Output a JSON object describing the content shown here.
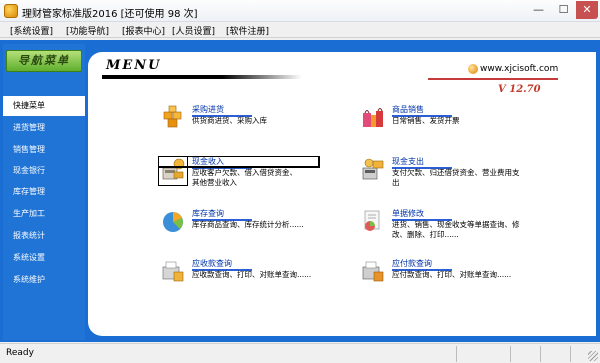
{
  "window": {
    "title": "理财管家标准版2016 [还可使用 98 次]",
    "minimize_glyph": "—",
    "maximize_glyph": "☐",
    "close_glyph": "✕"
  },
  "menubar": {
    "items": [
      "[系统设置]",
      "[功能导航]",
      "[报表中心]",
      "[人员设置]",
      "[软件注册]"
    ]
  },
  "sidebar": {
    "header": "导航菜单",
    "items": [
      "快捷菜单",
      "进货管理",
      "销售管理",
      "现金银行",
      "库存管理",
      "生产加工",
      "报表统计",
      "系统设置",
      "系统维护"
    ],
    "active_index": 0
  },
  "panel": {
    "logo": "MENU",
    "site": "www.xjcisoft.com",
    "version": "V 12.70",
    "items": [
      {
        "title": "采购进货",
        "desc": "供货商进货、采购入库",
        "icon": "purchase-icon"
      },
      {
        "title": "商品销售",
        "desc": "日常销售、发货开票",
        "icon": "sales-icon"
      },
      {
        "title": "现金收入",
        "desc": "应收客户欠款、借入借贷资金、其他营业收入",
        "icon": "cash-income-icon"
      },
      {
        "title": "现金支出",
        "desc": "支付欠款、归还借贷资金、营业费用支出",
        "icon": "cash-expense-icon"
      },
      {
        "title": "库存查询",
        "desc": "库存商品查询、库存统计分析......",
        "icon": "inventory-icon"
      },
      {
        "title": "单据修改",
        "desc": "进货、销售、现金收支等单据查询、修改、删除、打印......",
        "icon": "document-edit-icon"
      },
      {
        "title": "应收款查询",
        "desc": "应收款查询、打印、对账单查询......",
        "icon": "receivable-icon"
      },
      {
        "title": "应付款查询",
        "desc": "应付款查询、打印、对账单查询......",
        "icon": "payable-icon"
      }
    ]
  },
  "statusbar": {
    "text": "Ready"
  },
  "colors": {
    "frame_blue": "#1a6ed3",
    "link_blue": "#0033aa",
    "version_red": "#c0392b"
  }
}
